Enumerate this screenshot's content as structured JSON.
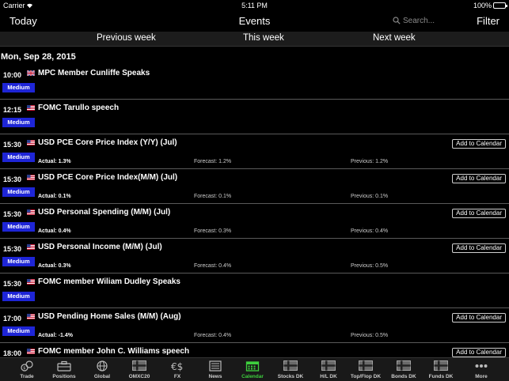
{
  "status": {
    "carrier": "Carrier",
    "time": "5:11 PM",
    "battery": "100%",
    "battery_level": 1.0
  },
  "nav": {
    "left": "Today",
    "title": "Events",
    "search_placeholder": "Search...",
    "right": "Filter"
  },
  "weeks": {
    "prev": "Previous week",
    "this": "This week",
    "next": "Next week"
  },
  "date": "Mon, Sep 28, 2015",
  "add_label": "Add to Calendar",
  "events": [
    {
      "time": "10:00",
      "country": "uk-flag",
      "title": "MPC Member Cunliffe Speaks",
      "impact": "Medium",
      "has_values": false
    },
    {
      "time": "12:15",
      "country": "us-flag",
      "title": "FOMC Tarullo speech",
      "impact": "Medium",
      "has_values": false
    },
    {
      "time": "15:30",
      "country": "us-flag",
      "title": "USD PCE Core Price Index (Y/Y) (Jul)",
      "impact": "Medium",
      "has_values": true,
      "actual": "Actual: 1.3%",
      "forecast": "Forecast: 1.2%",
      "previous": "Previous: 1.2%"
    },
    {
      "time": "15:30",
      "country": "us-flag",
      "title": "USD PCE Core Price Index(M/M) (Jul)",
      "impact": "Medium",
      "has_values": true,
      "actual": "Actual: 0.1%",
      "forecast": "Forecast: 0.1%",
      "previous": "Previous: 0.1%"
    },
    {
      "time": "15:30",
      "country": "us-flag",
      "title": "USD Personal Spending (M/M) (Jul)",
      "impact": "Medium",
      "has_values": true,
      "actual": "Actual: 0.4%",
      "forecast": "Forecast: 0.3%",
      "previous": "Previous: 0.4%"
    },
    {
      "time": "15:30",
      "country": "us-flag",
      "title": "USD Personal Income (M/M) (Jul)",
      "impact": "Medium",
      "has_values": true,
      "actual": "Actual: 0.3%",
      "forecast": "Forecast: 0.4%",
      "previous": "Previous: 0.5%"
    },
    {
      "time": "15:30",
      "country": "us-flag",
      "title": "FOMC member Wiliam Dudley Speaks",
      "impact": "Medium",
      "has_values": false
    },
    {
      "time": "17:00",
      "country": "us-flag",
      "title": "USD Pending Home Sales (M/M) (Aug)",
      "impact": "Medium",
      "has_values": true,
      "actual": "Actual: -1.4%",
      "forecast": "Forecast: 0.4%",
      "previous": "Previous: 0.5%"
    },
    {
      "time": "18:00",
      "country": "us-flag",
      "title": "FOMC member John C. Williams speech",
      "impact": "Medium",
      "has_values": true,
      "actual": "",
      "forecast": "",
      "previous": ""
    }
  ],
  "tabs": [
    {
      "label": "Trade",
      "icon": "trade-icon"
    },
    {
      "label": "Positions",
      "icon": "briefcase-icon"
    },
    {
      "label": "Global",
      "icon": "globe-icon"
    },
    {
      "label": "OMXC20",
      "icon": "danish-flag-icon"
    },
    {
      "label": "FX",
      "icon": "currency-icon"
    },
    {
      "label": "News",
      "icon": "newspaper-icon"
    },
    {
      "label": "Calendar",
      "icon": "calendar-icon",
      "active": true
    },
    {
      "label": "Stocks DK",
      "icon": "danish-flag-icon"
    },
    {
      "label": "H/L DK",
      "icon": "danish-flag-icon"
    },
    {
      "label": "Top/Flop DK",
      "icon": "danish-flag-icon"
    },
    {
      "label": "Bonds DK",
      "icon": "danish-flag-icon"
    },
    {
      "label": "Funds DK",
      "icon": "danish-flag-icon"
    },
    {
      "label": "More",
      "icon": "more-dots-icon"
    }
  ],
  "colors": {
    "badge": "#1e25d6",
    "active_tab": "#3ecf3e",
    "background": "#000000"
  }
}
